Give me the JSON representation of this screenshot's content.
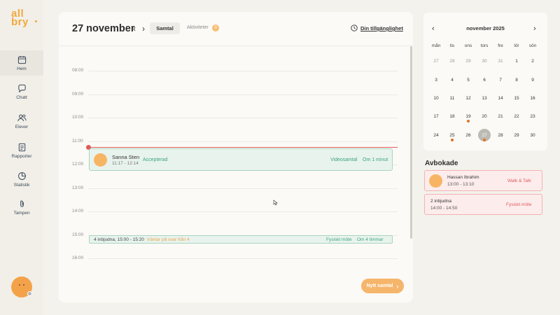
{
  "logo": {
    "line1": "all",
    "line2": "bry"
  },
  "sidebar": {
    "items": [
      {
        "label": "Hem",
        "icon": "calendar-icon"
      },
      {
        "label": "Chatt",
        "icon": "chat-icon"
      },
      {
        "label": "Elever",
        "icon": "users-icon"
      },
      {
        "label": "Rapporter",
        "icon": "report-icon"
      },
      {
        "label": "Statistik",
        "icon": "pie-chart-icon"
      },
      {
        "label": "Tampen",
        "icon": "paperclip-icon"
      }
    ]
  },
  "header": {
    "date": "27 november",
    "tab_samtal": "Samtal",
    "tab_aktiviteter": "Aktiviteter",
    "aktiviteter_badge": "0",
    "availability": "Din tillgänglighet"
  },
  "timeline": {
    "hours": [
      "08:00",
      "09:00",
      "10:00",
      "11:00",
      "12:00",
      "13:00",
      "14:00",
      "15:00",
      "16:00"
    ]
  },
  "events": {
    "first": {
      "name": "Sanna Sten",
      "time": "11:17 - 12:14",
      "status": "Accepterad",
      "type": "Videosamtal",
      "when": "Om 1 minut"
    },
    "second": {
      "text": "4 inbjudna, 15:00 - 15:20",
      "waiting": "Väntar på svar från 4",
      "type": "Fysiskt möte",
      "when": "Om 4 timmar"
    }
  },
  "new_button": "Nytt samtal",
  "calendar": {
    "month": "november 2025",
    "weekdays": [
      "mån",
      "tis",
      "ons",
      "tors",
      "fre",
      "lör",
      "sön"
    ],
    "rows": [
      [
        "27",
        "28",
        "29",
        "30",
        "31",
        "1",
        "2"
      ],
      [
        "3",
        "4",
        "5",
        "6",
        "7",
        "8",
        "9"
      ],
      [
        "10",
        "11",
        "12",
        "13",
        "14",
        "15",
        "16"
      ],
      [
        "17",
        "18",
        "19",
        "20",
        "21",
        "22",
        "23"
      ],
      [
        "24",
        "25",
        "26",
        "27",
        "28",
        "29",
        "30"
      ]
    ]
  },
  "avbokade": {
    "title": "Avbokade",
    "items": [
      {
        "name": "Hassan Ibrahim",
        "time": "13:00 - 13:10",
        "type": "Walk & Talk"
      },
      {
        "name": "2 inbjudna",
        "time": "14:00 - 14:50",
        "type": "Fysiskt möte"
      }
    ]
  },
  "colors": {
    "accent": "#f5b56a",
    "now_line": "#e15a5a",
    "green": "#3aa47a",
    "cancel_red": "#e05a5a"
  }
}
